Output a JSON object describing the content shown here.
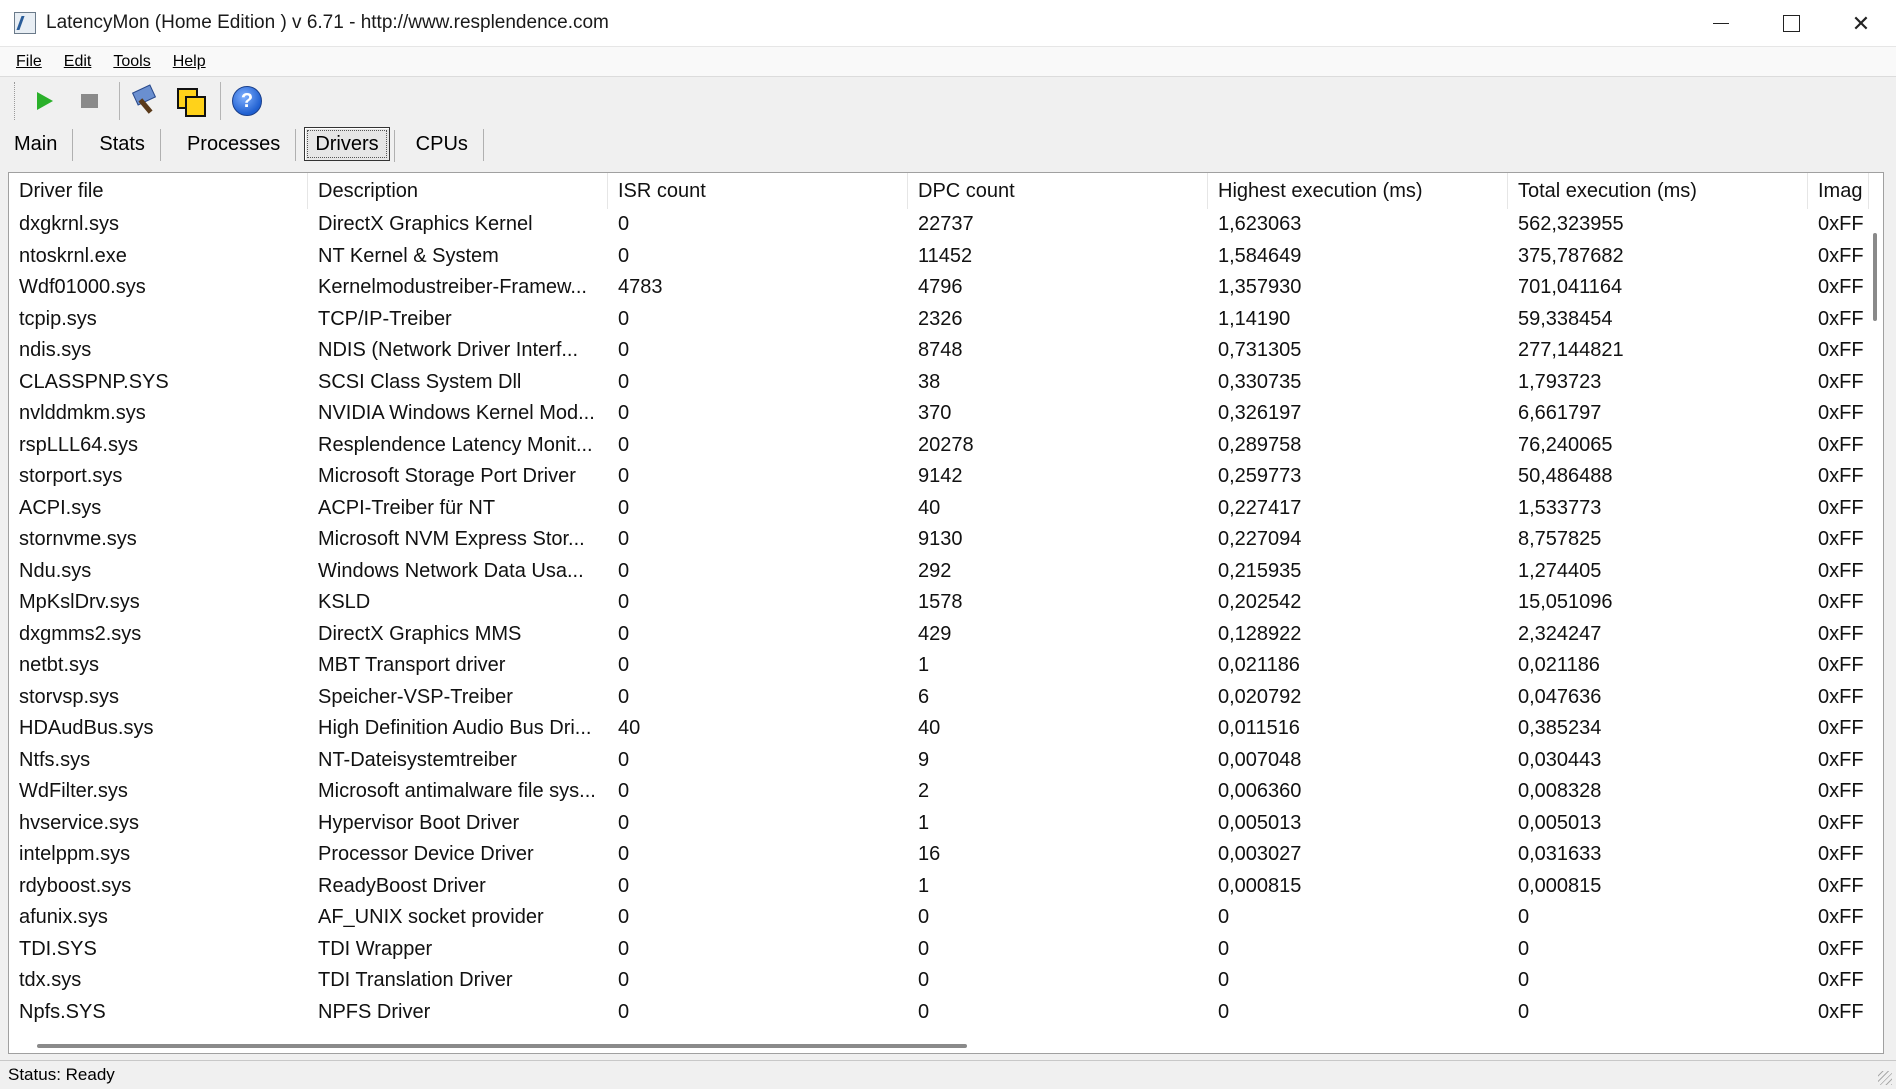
{
  "window": {
    "title": "LatencyMon  (Home Edition )  v 6.71 - http://www.resplendence.com",
    "close_glyph": "✕"
  },
  "menu": [
    "File",
    "Edit",
    "Tools",
    "Help"
  ],
  "toolbar": {
    "buttons": [
      "play-icon",
      "stop-icon",
      "tools-icon",
      "copy-icon",
      "help-icon"
    ],
    "help_glyph": "?"
  },
  "tabs": [
    {
      "label": "Main",
      "active": false
    },
    {
      "label": "Stats",
      "active": false
    },
    {
      "label": "Processes",
      "active": false
    },
    {
      "label": "Drivers",
      "active": true
    },
    {
      "label": "CPUs",
      "active": false
    }
  ],
  "table": {
    "columns": [
      "Driver file",
      "Description",
      "ISR count",
      "DPC count",
      "Highest execution (ms)",
      "Total execution (ms)",
      "Imag"
    ],
    "rows": [
      [
        "dxgkrnl.sys",
        "DirectX Graphics Kernel",
        "0",
        "22737",
        "1,623063",
        "562,323955",
        "0xFF"
      ],
      [
        "ntoskrnl.exe",
        "NT Kernel & System",
        "0",
        "11452",
        "1,584649",
        "375,787682",
        "0xFF"
      ],
      [
        "Wdf01000.sys",
        "Kernelmodustreiber-Framew...",
        "4783",
        "4796",
        "1,357930",
        "701,041164",
        "0xFF"
      ],
      [
        "tcpip.sys",
        "TCP/IP-Treiber",
        "0",
        "2326",
        "1,14190",
        "59,338454",
        "0xFF"
      ],
      [
        "ndis.sys",
        "NDIS (Network Driver Interf...",
        "0",
        "8748",
        "0,731305",
        "277,144821",
        "0xFF"
      ],
      [
        "CLASSPNP.SYS",
        "SCSI Class System Dll",
        "0",
        "38",
        "0,330735",
        "1,793723",
        "0xFF"
      ],
      [
        "nvlddmkm.sys",
        "NVIDIA Windows Kernel Mod...",
        "0",
        "370",
        "0,326197",
        "6,661797",
        "0xFF"
      ],
      [
        "rspLLL64.sys",
        "Resplendence Latency Monit...",
        "0",
        "20278",
        "0,289758",
        "76,240065",
        "0xFF"
      ],
      [
        "storport.sys",
        "Microsoft Storage Port Driver",
        "0",
        "9142",
        "0,259773",
        "50,486488",
        "0xFF"
      ],
      [
        "ACPI.sys",
        "ACPI-Treiber für NT",
        "0",
        "40",
        "0,227417",
        "1,533773",
        "0xFF"
      ],
      [
        "stornvme.sys",
        "Microsoft NVM Express Stor...",
        "0",
        "9130",
        "0,227094",
        "8,757825",
        "0xFF"
      ],
      [
        "Ndu.sys",
        "Windows Network Data Usa...",
        "0",
        "292",
        "0,215935",
        "1,274405",
        "0xFF"
      ],
      [
        "MpKslDrv.sys",
        "KSLD",
        "0",
        "1578",
        "0,202542",
        "15,051096",
        "0xFF"
      ],
      [
        "dxgmms2.sys",
        "DirectX Graphics MMS",
        "0",
        "429",
        "0,128922",
        "2,324247",
        "0xFF"
      ],
      [
        "netbt.sys",
        "MBT Transport driver",
        "0",
        "1",
        "0,021186",
        "0,021186",
        "0xFF"
      ],
      [
        "storvsp.sys",
        "Speicher-VSP-Treiber",
        "0",
        "6",
        "0,020792",
        "0,047636",
        "0xFF"
      ],
      [
        "HDAudBus.sys",
        "High Definition Audio Bus Dri...",
        "40",
        "40",
        "0,011516",
        "0,385234",
        "0xFF"
      ],
      [
        "Ntfs.sys",
        "NT-Dateisystemtreiber",
        "0",
        "9",
        "0,007048",
        "0,030443",
        "0xFF"
      ],
      [
        "WdFilter.sys",
        "Microsoft antimalware file sys...",
        "0",
        "2",
        "0,006360",
        "0,008328",
        "0xFF"
      ],
      [
        "hvservice.sys",
        "Hypervisor Boot Driver",
        "0",
        "1",
        "0,005013",
        "0,005013",
        "0xFF"
      ],
      [
        "intelppm.sys",
        "Processor Device Driver",
        "0",
        "16",
        "0,003027",
        "0,031633",
        "0xFF"
      ],
      [
        "rdyboost.sys",
        "ReadyBoost Driver",
        "0",
        "1",
        "0,000815",
        "0,000815",
        "0xFF"
      ],
      [
        "afunix.sys",
        "AF_UNIX socket provider",
        "0",
        "0",
        "0",
        "0",
        "0xFF"
      ],
      [
        "TDI.SYS",
        "TDI Wrapper",
        "0",
        "0",
        "0",
        "0",
        "0xFF"
      ],
      [
        "tdx.sys",
        "TDI Translation Driver",
        "0",
        "0",
        "0",
        "0",
        "0xFF"
      ],
      [
        "Npfs.SYS",
        "NPFS Driver",
        "0",
        "0",
        "0",
        "0",
        "0xFF"
      ]
    ]
  },
  "status": "Status: Ready"
}
